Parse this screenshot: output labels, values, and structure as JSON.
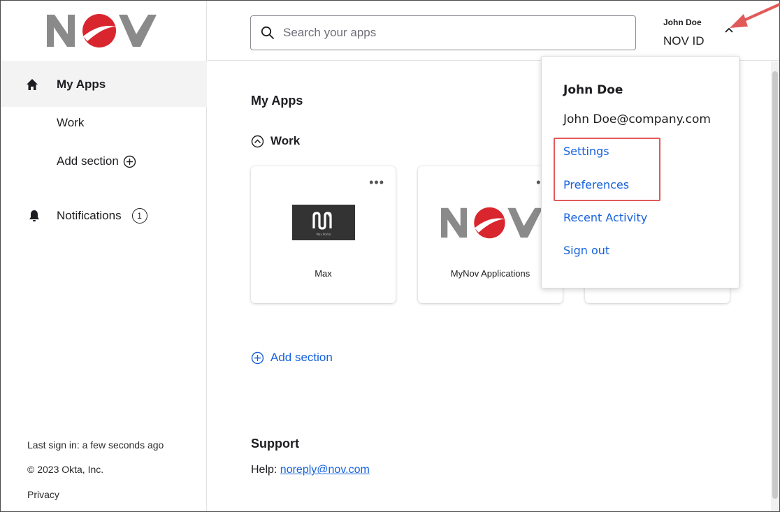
{
  "header": {
    "search_placeholder": "Search your apps",
    "user_name": "John Doe",
    "user_org": "NOV ID"
  },
  "sidebar": {
    "items": [
      {
        "label": "My Apps",
        "icon": "home-icon",
        "active": true
      },
      {
        "label": "Work"
      },
      {
        "label": "Add section",
        "icon": "plus-circle-icon"
      },
      {
        "label": "Notifications",
        "icon": "bell-icon",
        "badge": "1"
      }
    ],
    "footer": {
      "last_sign_in": "Last sign in: a few seconds ago",
      "copyright": "© 2023 Okta, Inc.",
      "privacy": "Privacy"
    }
  },
  "main": {
    "title": "My Apps",
    "section": {
      "label": "Work",
      "apps": [
        {
          "label": "Max",
          "logo_text": "Max Portal"
        },
        {
          "label": "MyNov Applications"
        },
        {
          "label": ""
        }
      ]
    },
    "add_section": "Add section",
    "support": {
      "title": "Support",
      "help_label": "Help: ",
      "help_email": "noreply@nov.com"
    }
  },
  "user_menu": {
    "name": "John Doe",
    "email": "John Doe@company.com",
    "items": [
      "Settings",
      "Preferences",
      "Recent Activity",
      "Sign out"
    ]
  },
  "colors": {
    "link": "#1662dd",
    "annotation_red": "#e15a5a",
    "nov_red": "#d9262e",
    "nov_gray": "#8a8a8a"
  }
}
